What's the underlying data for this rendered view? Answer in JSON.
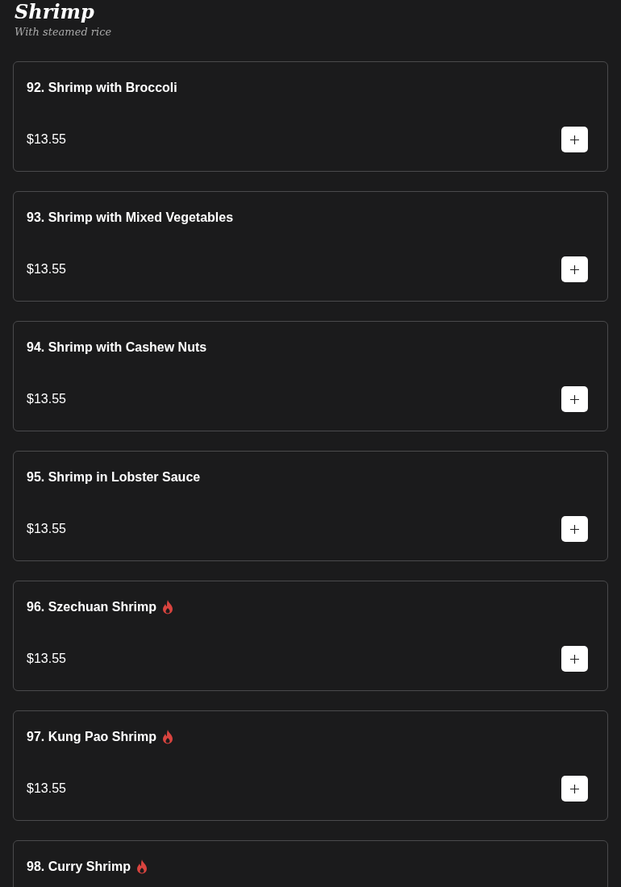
{
  "section": {
    "title": "Shrimp",
    "subtitle": "With steamed rice"
  },
  "items": [
    {
      "name": "92. Shrimp with Broccoli",
      "spicy": false,
      "price": "$13.55"
    },
    {
      "name": "93. Shrimp with Mixed Vegetables",
      "spicy": false,
      "price": "$13.55"
    },
    {
      "name": "94. Shrimp with Cashew Nuts",
      "spicy": false,
      "price": "$13.55"
    },
    {
      "name": "95. Shrimp in Lobster Sauce",
      "spicy": false,
      "price": "$13.55"
    },
    {
      "name": "96. Szechuan Shrimp",
      "spicy": true,
      "price": "$13.55"
    },
    {
      "name": "97. Kung Pao Shrimp",
      "spicy": true,
      "price": "$13.55"
    },
    {
      "name": "98. Curry Shrimp",
      "spicy": true
    }
  ]
}
